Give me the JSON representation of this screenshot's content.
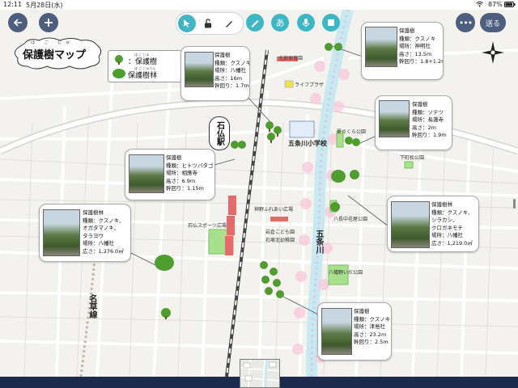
{
  "status_bar": {
    "time": "12:11",
    "date": "5月28日(水)",
    "wifi": "wifi-icon",
    "battery": "87%"
  },
  "toolbar": {
    "back_icon": "arrow-left-icon",
    "add_icon": "plus-icon",
    "select_icon": "pointer-icon",
    "lock_icon": "unlock-icon",
    "pen_icon": "pencil-icon",
    "pen2_icon": "marker-icon",
    "text_label": "あ",
    "mic_icon": "microphone-icon",
    "stop_icon": "square-icon",
    "more_icon": "ellipsis-icon",
    "send_label": "送る"
  },
  "map": {
    "title": "保護樹マップ",
    "title_ruby": "ほ ご じゅ",
    "legend": [
      {
        "ruby": "ほ ご じゅ",
        "label": "：保護樹"
      },
      {
        "ruby": "ほ ご じゅりん",
        "label": "保護樹林"
      }
    ],
    "labels": {
      "station": "石仏駅",
      "school": "五条川小学校",
      "river": "五条川",
      "rail": "名草線",
      "park1": "夏さくら公園",
      "park2": "下町松公園",
      "park3": "八長中花屋公園",
      "park4": "八幡野いだ公園",
      "park5": "石仏スポーツ広場",
      "park6": "神野ふれあい広場",
      "park7": "岩倉こども園",
      "park8": "石塚北幼稚園",
      "park9": "北部保育園",
      "lifeplaza": "ライフプラザ"
    },
    "cards": [
      {
        "type": "保護樹",
        "kind": "種類：クスノキ",
        "place": "場所：八幡社",
        "height": "高さ：16m",
        "girth": "幹回り：1.7m"
      },
      {
        "type": "保護樹",
        "kind": "種類：クスノキ",
        "place": "場所：神明社",
        "height": "高さ：13.5m",
        "girth": "幹回り：1.8+1.2m"
      },
      {
        "type": "保護樹",
        "kind": "種類：ソテツ",
        "place": "場所：長蓮寺",
        "height": "高さ：2m",
        "girth": "幹回り：1.9m"
      },
      {
        "type": "保護樹",
        "kind": "種類：ヒトツバタゴ",
        "place": "場所：相應寺",
        "height": "高さ：6.9m",
        "girth": "幹回り：1.15m"
      },
      {
        "type": "保護樹林",
        "kind": "種類：クスノキ、",
        "kind2": "オガタマノキ、",
        "kind3": "タラヨウ",
        "place": "場所：八幡社",
        "height": "広さ：1,276.0㎡"
      },
      {
        "type": "保護樹林",
        "kind": "種類：クスノキ、",
        "kind2": "シラカシ、",
        "kind3": "クロガネモチ",
        "place": "場所：八幡社",
        "height": "広さ：1,219.0㎡"
      },
      {
        "type": "保護樹",
        "kind": "種類：クスノキ",
        "place": "場所：津島社",
        "height": "高さ：23.2m",
        "girth": "幹回り：2.5m"
      }
    ]
  }
}
